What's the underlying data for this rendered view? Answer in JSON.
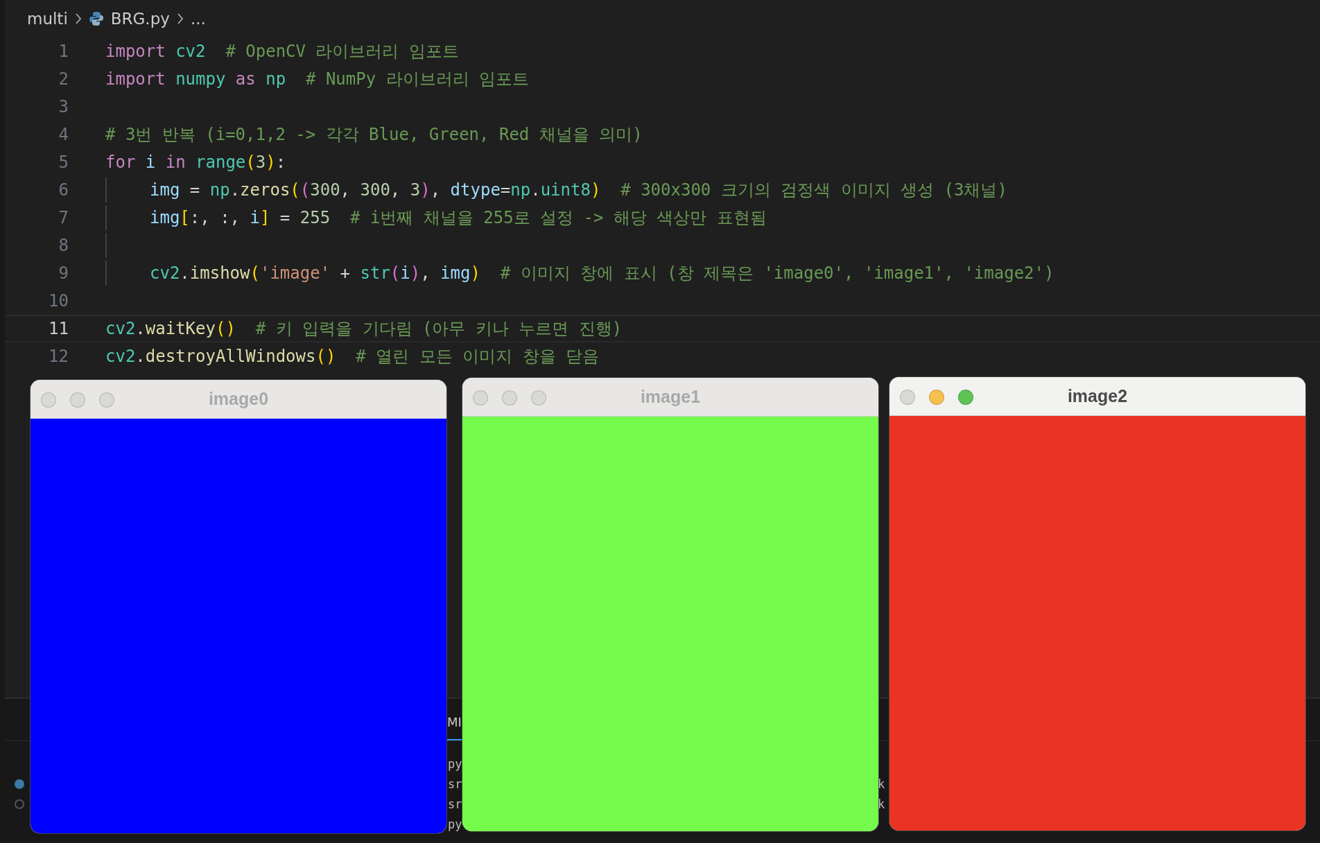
{
  "breadcrumb": {
    "folder": "multi",
    "file": "BRG.py",
    "more": "..."
  },
  "code_lines": [
    {
      "number": "1",
      "current": false,
      "in_block": false,
      "tokens": [
        {
          "text": "import ",
          "kind": "keyword"
        },
        {
          "text": "cv2",
          "kind": "module"
        },
        {
          "text": "  # OpenCV 라이브러리 임포트",
          "kind": "comment"
        }
      ]
    },
    {
      "number": "2",
      "current": false,
      "in_block": false,
      "tokens": [
        {
          "text": "import ",
          "kind": "keyword"
        },
        {
          "text": "numpy ",
          "kind": "module"
        },
        {
          "text": "as ",
          "kind": "keyword"
        },
        {
          "text": "np",
          "kind": "module"
        },
        {
          "text": "  # NumPy 라이브러리 임포트",
          "kind": "comment"
        }
      ]
    },
    {
      "number": "3",
      "current": false,
      "in_block": false
    },
    {
      "number": "4",
      "current": false,
      "in_block": false,
      "tokens": [
        {
          "text": "# 3번 반복 (i=0,1,2 -> 각각 Blue, Green, Red 채널을 의미)",
          "kind": "comment"
        }
      ]
    },
    {
      "number": "5",
      "current": false,
      "in_block": false,
      "tokens": [
        {
          "text": "for ",
          "kind": "keyword"
        },
        {
          "text": "i ",
          "kind": "variable"
        },
        {
          "text": "in ",
          "kind": "keyword"
        },
        {
          "text": "range",
          "kind": "module"
        },
        {
          "text": "(",
          "kind": "bracket1"
        },
        {
          "text": "3",
          "kind": "number"
        },
        {
          "text": ")",
          "kind": "bracket1"
        },
        {
          "text": ":",
          "kind": "plain"
        }
      ]
    },
    {
      "number": "6",
      "current": false,
      "in_block": true,
      "tokens": [
        {
          "text": "img",
          "kind": "variable"
        },
        {
          "text": " = ",
          "kind": "plain"
        },
        {
          "text": "np",
          "kind": "module"
        },
        {
          "text": ".",
          "kind": "plain"
        },
        {
          "text": "zeros",
          "kind": "function"
        },
        {
          "text": "(",
          "kind": "bracket1"
        },
        {
          "text": "(",
          "kind": "bracket2"
        },
        {
          "text": "300",
          "kind": "number"
        },
        {
          "text": ", ",
          "kind": "plain"
        },
        {
          "text": "300",
          "kind": "number"
        },
        {
          "text": ", ",
          "kind": "plain"
        },
        {
          "text": "3",
          "kind": "number"
        },
        {
          "text": ")",
          "kind": "bracket2"
        },
        {
          "text": ", ",
          "kind": "plain"
        },
        {
          "text": "dtype",
          "kind": "variable"
        },
        {
          "text": "=",
          "kind": "plain"
        },
        {
          "text": "np",
          "kind": "module"
        },
        {
          "text": ".",
          "kind": "plain"
        },
        {
          "text": "uint8",
          "kind": "module"
        },
        {
          "text": ")",
          "kind": "bracket1"
        },
        {
          "text": "  # 300x300 크기의 검정색 이미지 생성 (3채널)",
          "kind": "comment"
        }
      ]
    },
    {
      "number": "7",
      "current": false,
      "in_block": true,
      "tokens": [
        {
          "text": "img",
          "kind": "variable"
        },
        {
          "text": "[",
          "kind": "bracket1"
        },
        {
          "text": ":, :, ",
          "kind": "plain"
        },
        {
          "text": "i",
          "kind": "variable"
        },
        {
          "text": "]",
          "kind": "bracket1"
        },
        {
          "text": " = ",
          "kind": "plain"
        },
        {
          "text": "255",
          "kind": "number"
        },
        {
          "text": "  # i번째 채널을 255로 설정 -> 해당 색상만 표현됨",
          "kind": "comment"
        }
      ]
    },
    {
      "number": "8",
      "current": false,
      "in_block": true
    },
    {
      "number": "9",
      "current": false,
      "in_block": true,
      "tokens": [
        {
          "text": "cv2",
          "kind": "module"
        },
        {
          "text": ".",
          "kind": "plain"
        },
        {
          "text": "imshow",
          "kind": "function"
        },
        {
          "text": "(",
          "kind": "bracket1"
        },
        {
          "text": "'image'",
          "kind": "string"
        },
        {
          "text": " + ",
          "kind": "plain"
        },
        {
          "text": "str",
          "kind": "module"
        },
        {
          "text": "(",
          "kind": "bracket2"
        },
        {
          "text": "i",
          "kind": "variable"
        },
        {
          "text": ")",
          "kind": "bracket2"
        },
        {
          "text": ", ",
          "kind": "plain"
        },
        {
          "text": "img",
          "kind": "variable"
        },
        {
          "text": ")",
          "kind": "bracket1"
        },
        {
          "text": "  # 이미지 창에 표시 (창 제목은 'image0', 'image1', 'image2')",
          "kind": "comment"
        }
      ]
    },
    {
      "number": "10",
      "current": false,
      "in_block": false
    },
    {
      "number": "11",
      "current": true,
      "in_block": false,
      "tokens": [
        {
          "text": "cv2",
          "kind": "module"
        },
        {
          "text": ".",
          "kind": "plain"
        },
        {
          "text": "waitKey",
          "kind": "function"
        },
        {
          "text": "()",
          "kind": "bracket1"
        },
        {
          "text": "  # 키 입력을 기다림 (아무 키나 누르면 진행)",
          "kind": "comment"
        }
      ]
    },
    {
      "number": "12",
      "current": false,
      "in_block": false,
      "tokens": [
        {
          "text": "cv2",
          "kind": "module"
        },
        {
          "text": ".",
          "kind": "plain"
        },
        {
          "text": "destroyAllWindows",
          "kind": "function"
        },
        {
          "text": "()",
          "kind": "bracket1"
        },
        {
          "text": "  # 열린 모든 이미지 창을 닫음",
          "kind": "comment"
        }
      ]
    }
  ],
  "terminal": {
    "tab": "MI",
    "rows": [
      {
        "kind": "plain",
        "left": "py"
      },
      {
        "kind": "filled",
        "left": "sr",
        "right": "k"
      },
      {
        "kind": "hollow",
        "left": "sr",
        "right": "k"
      },
      {
        "kind": "plain",
        "left": "py"
      }
    ]
  },
  "windows": [
    {
      "title": "image0",
      "active": false,
      "color": "#0000ff"
    },
    {
      "title": "image1",
      "active": false,
      "color": "#75fb4c"
    },
    {
      "title": "image2",
      "active": true,
      "color": "#ea3323"
    }
  ]
}
